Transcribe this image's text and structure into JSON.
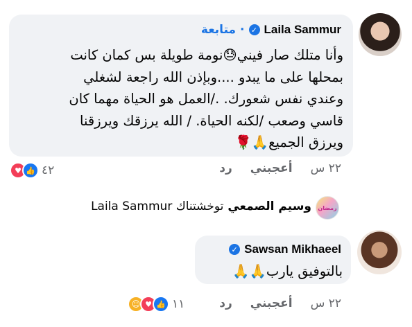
{
  "comment1": {
    "author": "Laila Sammur",
    "follow_label": "متابعة",
    "dot": "·",
    "lines": [
      "وأنا متلك صار فيني😓نومة طويلة بس كمان كانت",
      "بمحلها على ما يبدو ....وبإذن الله راجعة لشغلي",
      "وعندي نفس شعورك. ./العمل هو الحياة مهما كان",
      "قاسي وصعب /لكنه الحياة. / الله يرزقك ويرزقنا",
      "ويرزق الجميع🙏🌹"
    ],
    "time": "٢٢ س",
    "like_label": "أعجبني",
    "reply_label": "رد",
    "reactions_count": "٤٢"
  },
  "reply_summary": {
    "avatar_text": "رمضان",
    "name": "وسيم الصمعي",
    "text": "توخشتناك Laila Sammur"
  },
  "comment2": {
    "author": "Sawsan Mikhaeel",
    "text": "بالتوفيق يارب🙏🙏",
    "time": "٢٢ س",
    "like_label": "أعجبني",
    "reply_label": "رد",
    "reactions_count": "١١"
  },
  "icons": {
    "verified": "verified-badge-icon",
    "like": "like-reaction-icon",
    "love": "love-reaction-icon",
    "care": "care-reaction-icon"
  },
  "colors": {
    "accent": "#1b74e4",
    "bubble": "#f0f2f5",
    "muted": "#65676b"
  }
}
